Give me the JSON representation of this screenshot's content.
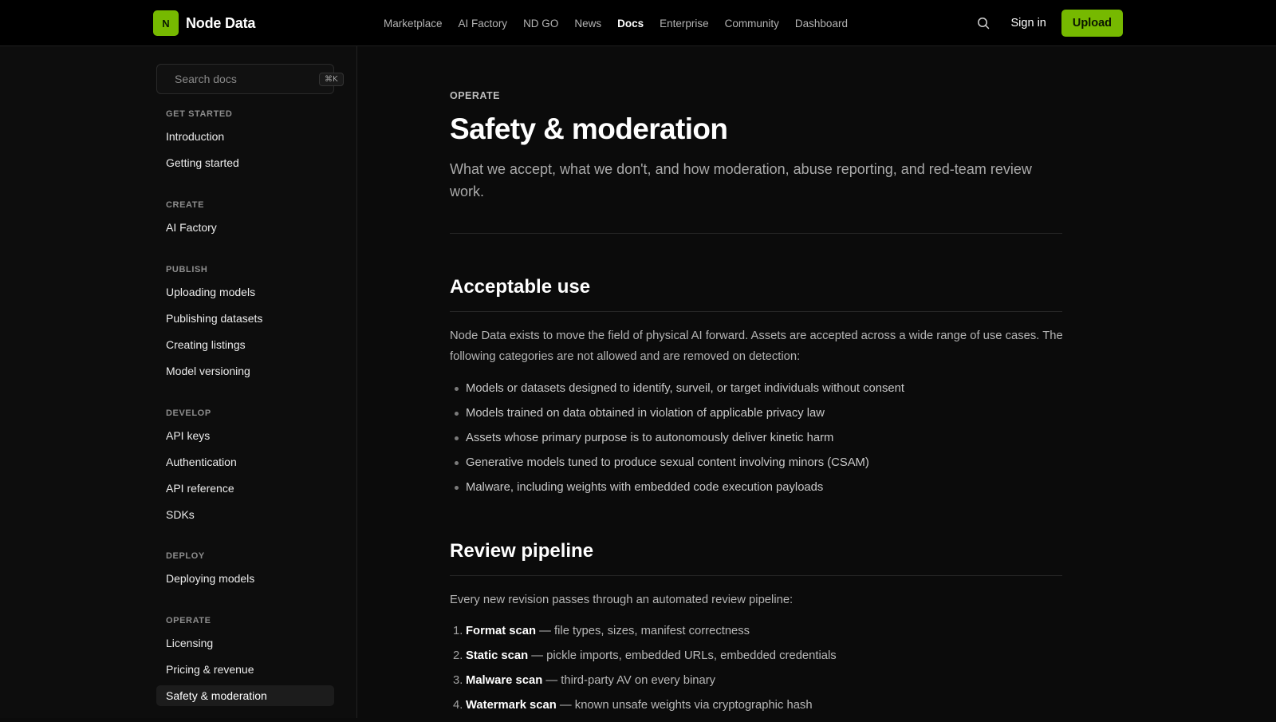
{
  "brand": {
    "logo_letter": "N",
    "name": "Node Data"
  },
  "nav": {
    "links": [
      {
        "label": "Marketplace"
      },
      {
        "label": "AI Factory"
      },
      {
        "label": "ND GO"
      },
      {
        "label": "News"
      },
      {
        "label": "Docs",
        "active": true
      },
      {
        "label": "Enterprise"
      },
      {
        "label": "Community"
      },
      {
        "label": "Dashboard"
      }
    ],
    "search_icon": "search-icon",
    "signin": "Sign in",
    "upload": "Upload"
  },
  "sidebar": {
    "search_placeholder": "Search docs",
    "shortcut": "⌘K",
    "groups": [
      {
        "heading": "GET STARTED",
        "items": [
          "Introduction",
          "Getting started"
        ]
      },
      {
        "heading": "CREATE",
        "items": [
          "AI Factory"
        ]
      },
      {
        "heading": "PUBLISH",
        "items": [
          "Uploading models",
          "Publishing datasets",
          "Creating listings",
          "Model versioning"
        ]
      },
      {
        "heading": "DEVELOP",
        "items": [
          "API keys",
          "Authentication",
          "API reference",
          "SDKs"
        ]
      },
      {
        "heading": "DEPLOY",
        "items": [
          "Deploying models"
        ]
      },
      {
        "heading": "OPERATE",
        "items": [
          "Licensing",
          "Pricing & revenue",
          "Safety & moderation"
        ]
      }
    ],
    "active_item": "Safety & moderation"
  },
  "page": {
    "eyebrow": "OPERATE",
    "title": "Safety & moderation",
    "subtitle": "What we accept, what we don't, and how moderation, abuse reporting, and red-team review work.",
    "sections": {
      "acceptable": {
        "heading": "Acceptable use",
        "intro": "Node Data exists to move the field of physical AI forward. Assets are accepted across a wide range of use cases. The following categories are not allowed and are removed on detection:",
        "bullets": [
          "Models or datasets designed to identify, surveil, or target individuals without consent",
          "Models trained on data obtained in violation of applicable privacy law",
          "Assets whose primary purpose is to autonomously deliver kinetic harm",
          "Generative models tuned to produce sexual content involving minors (CSAM)",
          "Malware, including weights with embedded code execution payloads"
        ]
      },
      "review": {
        "heading": "Review pipeline",
        "intro": "Every new revision passes through an automated review pipeline:",
        "steps": [
          {
            "num": "1.",
            "name": "Format scan",
            "desc": " — file types, sizes, manifest correctness"
          },
          {
            "num": "2.",
            "name": "Static scan",
            "desc": " — pickle imports, embedded URLs, embedded credentials"
          },
          {
            "num": "3.",
            "name": "Malware scan",
            "desc": " — third-party AV on every binary"
          },
          {
            "num": "4.",
            "name": "Watermark scan",
            "desc": " — known unsafe weights via cryptographic hash"
          }
        ]
      }
    }
  },
  "colors": {
    "accent": "#76b900",
    "background": "#0b0b0b",
    "nav_bg": "#000000"
  }
}
